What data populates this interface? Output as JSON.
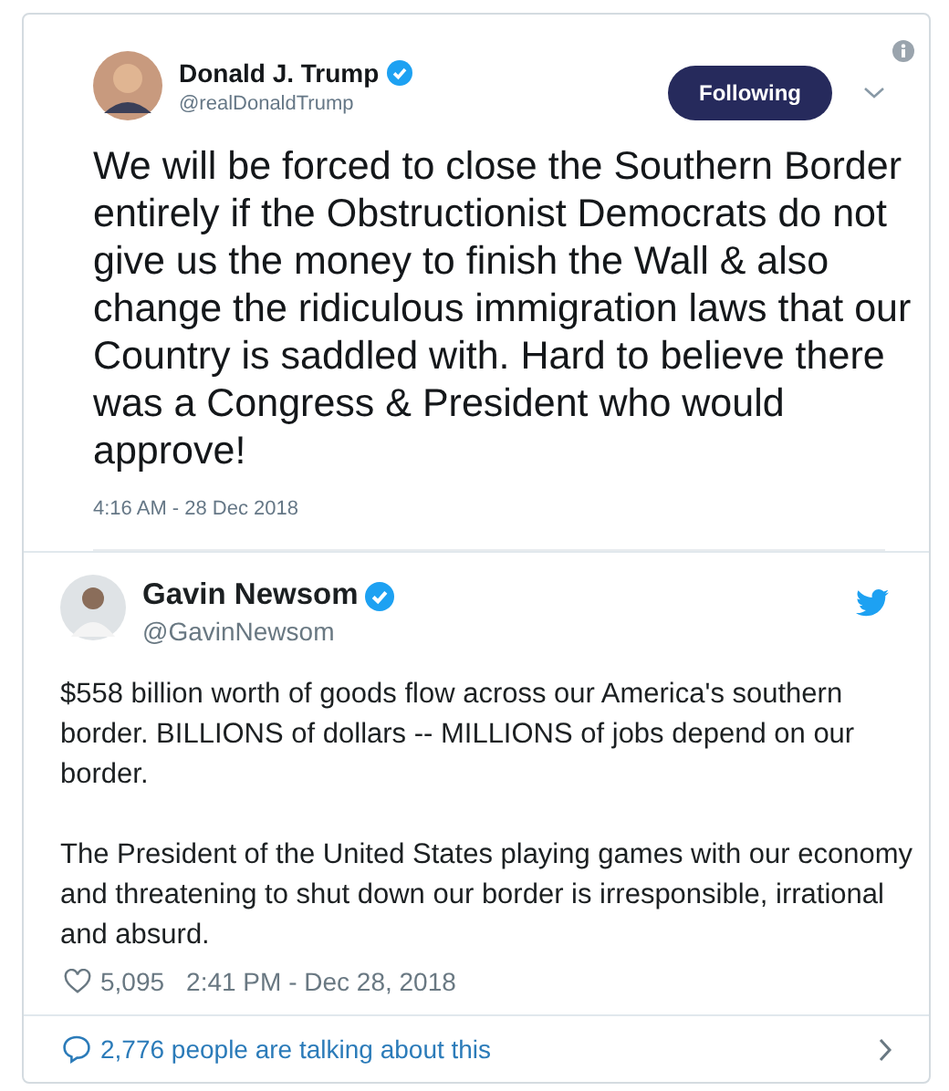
{
  "quoted_tweet": {
    "name": "Donald J. Trump",
    "verified": true,
    "handle": "@realDonaldTrump",
    "follow_button": "Following",
    "text": "We will be forced to close the Southern Border entirely if the Obstructionist Democrats do not give us the money to finish the Wall & also change the ridiculous immigration laws that our Country is saddled with. Hard to believe there was a Congress & President who would approve!",
    "timestamp": "4:16 AM - 28 Dec 2018"
  },
  "tweet": {
    "name": "Gavin Newsom",
    "verified": true,
    "handle": "@GavinNewsom",
    "paragraphs": [
      "$558 billion worth of goods flow across our America's southern border. BILLIONS of dollars -- MILLIONS of jobs depend on our border.",
      "The President of the United States playing games with our economy and threatening to shut down our border is irresponsible, irrational and absurd."
    ],
    "likes": "5,095",
    "timestamp": "2:41 PM - Dec 28, 2018"
  },
  "footer": {
    "text": "2,776 people are talking about this"
  }
}
